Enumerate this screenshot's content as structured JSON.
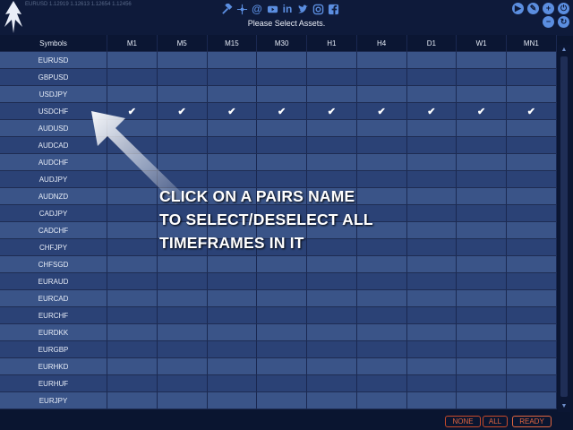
{
  "header": {
    "ticker": "EURUSD 1.12919 1.12613 1.12654 1.12456",
    "banner": "Please Select Assets.",
    "social_icons": [
      "tools-icon",
      "network-icon",
      "email-at-icon",
      "youtube-icon",
      "linkedin-icon",
      "twitter-icon",
      "instagram-icon",
      "facebook-icon"
    ],
    "control_icons": [
      "play-icon",
      "settings-icon",
      "add-icon",
      "power-icon",
      "minimize-icon",
      "refresh-icon"
    ]
  },
  "table": {
    "columns": [
      "Symbols",
      "M1",
      "M5",
      "M15",
      "M30",
      "H1",
      "H4",
      "D1",
      "W1",
      "MN1"
    ],
    "rows": [
      {
        "symbol": "EURUSD",
        "checks": [
          false,
          false,
          false,
          false,
          false,
          false,
          false,
          false,
          false
        ]
      },
      {
        "symbol": "GBPUSD",
        "checks": [
          false,
          false,
          false,
          false,
          false,
          false,
          false,
          false,
          false
        ]
      },
      {
        "symbol": "USDJPY",
        "checks": [
          false,
          false,
          false,
          false,
          false,
          false,
          false,
          false,
          false
        ]
      },
      {
        "symbol": "USDCHF",
        "checks": [
          true,
          true,
          true,
          true,
          true,
          true,
          true,
          true,
          true
        ]
      },
      {
        "symbol": "AUDUSD",
        "checks": [
          false,
          false,
          false,
          false,
          false,
          false,
          false,
          false,
          false
        ]
      },
      {
        "symbol": "AUDCAD",
        "checks": [
          false,
          false,
          false,
          false,
          false,
          false,
          false,
          false,
          false
        ]
      },
      {
        "symbol": "AUDCHF",
        "checks": [
          false,
          false,
          false,
          false,
          false,
          false,
          false,
          false,
          false
        ]
      },
      {
        "symbol": "AUDJPY",
        "checks": [
          false,
          false,
          false,
          false,
          false,
          false,
          false,
          false,
          false
        ]
      },
      {
        "symbol": "AUDNZD",
        "checks": [
          false,
          false,
          false,
          false,
          false,
          false,
          false,
          false,
          false
        ]
      },
      {
        "symbol": "CADJPY",
        "checks": [
          false,
          false,
          false,
          false,
          false,
          false,
          false,
          false,
          false
        ]
      },
      {
        "symbol": "CADCHF",
        "checks": [
          false,
          false,
          false,
          false,
          false,
          false,
          false,
          false,
          false
        ]
      },
      {
        "symbol": "CHFJPY",
        "checks": [
          false,
          false,
          false,
          false,
          false,
          false,
          false,
          false,
          false
        ]
      },
      {
        "symbol": "CHFSGD",
        "checks": [
          false,
          false,
          false,
          false,
          false,
          false,
          false,
          false,
          false
        ]
      },
      {
        "symbol": "EURAUD",
        "checks": [
          false,
          false,
          false,
          false,
          false,
          false,
          false,
          false,
          false
        ]
      },
      {
        "symbol": "EURCAD",
        "checks": [
          false,
          false,
          false,
          false,
          false,
          false,
          false,
          false,
          false
        ]
      },
      {
        "symbol": "EURCHF",
        "checks": [
          false,
          false,
          false,
          false,
          false,
          false,
          false,
          false,
          false
        ]
      },
      {
        "symbol": "EURDKK",
        "checks": [
          false,
          false,
          false,
          false,
          false,
          false,
          false,
          false,
          false
        ]
      },
      {
        "symbol": "EURGBP",
        "checks": [
          false,
          false,
          false,
          false,
          false,
          false,
          false,
          false,
          false
        ]
      },
      {
        "symbol": "EURHKD",
        "checks": [
          false,
          false,
          false,
          false,
          false,
          false,
          false,
          false,
          false
        ]
      },
      {
        "symbol": "EURHUF",
        "checks": [
          false,
          false,
          false,
          false,
          false,
          false,
          false,
          false,
          false
        ]
      },
      {
        "symbol": "EURJPY",
        "checks": [
          false,
          false,
          false,
          false,
          false,
          false,
          false,
          false,
          false
        ]
      }
    ],
    "check_glyph": "✔"
  },
  "overlay": {
    "lines": [
      "CLICK ON A PAIRS NAME",
      "TO SELECT/DESELECT ALL",
      "TIMEFRAMES IN IT"
    ]
  },
  "footer": {
    "none_label": "NONE",
    "all_label": "ALL",
    "ready_label": "READY"
  },
  "colors": {
    "row_light": "#3a5488",
    "row_dark": "#2b4276",
    "header_bg": "#0b1633",
    "icon_blue": "#5b8ee0",
    "footer_accent": "#e0653f"
  }
}
